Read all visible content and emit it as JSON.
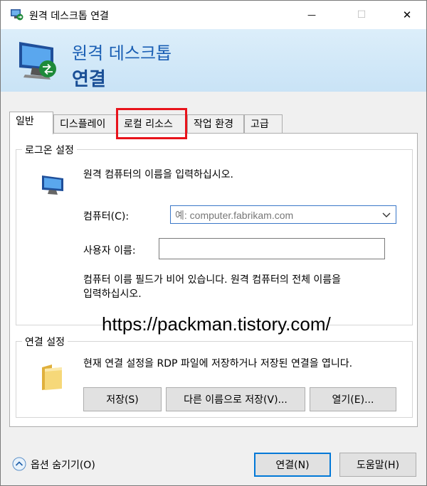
{
  "window": {
    "title": "원격 데스크톱 연결",
    "minimize_glyph": "—",
    "maximize_glyph": "☐",
    "close_glyph": "✕"
  },
  "banner": {
    "line1": "원격 데스크톱",
    "line2": "연결"
  },
  "tabs": [
    {
      "label": "일반",
      "active": true
    },
    {
      "label": "디스플레이"
    },
    {
      "label": "로컬 리소스",
      "highlighted": true
    },
    {
      "label": "작업 환경"
    },
    {
      "label": "고급"
    }
  ],
  "logon": {
    "legend": "로그온 설정",
    "instruction": "원격 컴퓨터의 이름을 입력하십시오.",
    "computer_label": "컴퓨터(C):",
    "computer_placeholder": "예: computer.fabrikam.com",
    "username_label": "사용자 이름:",
    "username_value": "",
    "hint_line1": "컴퓨터 이름 필드가 비어 있습니다. 원격 컴퓨터의 전체 이름을",
    "hint_line2": "입력하십시오."
  },
  "watermark": "https://packman.tistory.com/",
  "connection": {
    "legend": "연결 설정",
    "description": "현재 연결 설정을 RDP 파일에 저장하거나 저장된 연결을 엽니다.",
    "save_label": "저장(S)",
    "save_as_label": "다른 이름으로 저장(V)...",
    "open_label": "열기(E)..."
  },
  "footer": {
    "options_label": "옵션 숨기기(O)",
    "connect_label": "연결(N)",
    "help_label": "도움말(H)"
  },
  "colors": {
    "accent": "#0078d7",
    "highlight_box": "#e8131b",
    "banner_text": "#1a5fb4"
  }
}
